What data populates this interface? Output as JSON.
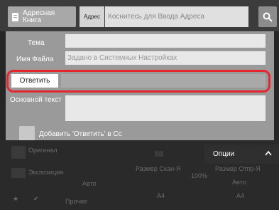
{
  "topbar": {
    "address_book_label": "Адресная\nКнига",
    "address_tag": "Адрес",
    "address_placeholder": "Коснитесь для Ввода Адреса"
  },
  "form": {
    "subject_label": "Тема",
    "subject_value": "",
    "filename_label": "Имя Файла",
    "filename_value": "Задано в Системных Настройках",
    "reply_label": "Ответить",
    "reply_value": "",
    "body_label": "Основной текст",
    "body_value": "",
    "add_reply_cc_label": "Добавить 'Ответить' в Cc"
  },
  "background": {
    "original_label": "Оригинал",
    "exposure_label": "Экспозиция",
    "exposure_value": "Авто",
    "other_label": "Прочие",
    "scan_size_label": "Размер Скан-Я",
    "send_size_label": "Размер Отпр-Я",
    "ratio_value": "100%",
    "auto_value": "Авто",
    "scan_size_value": "A4",
    "send_size_value": "A4",
    "options_label": "Опции"
  }
}
